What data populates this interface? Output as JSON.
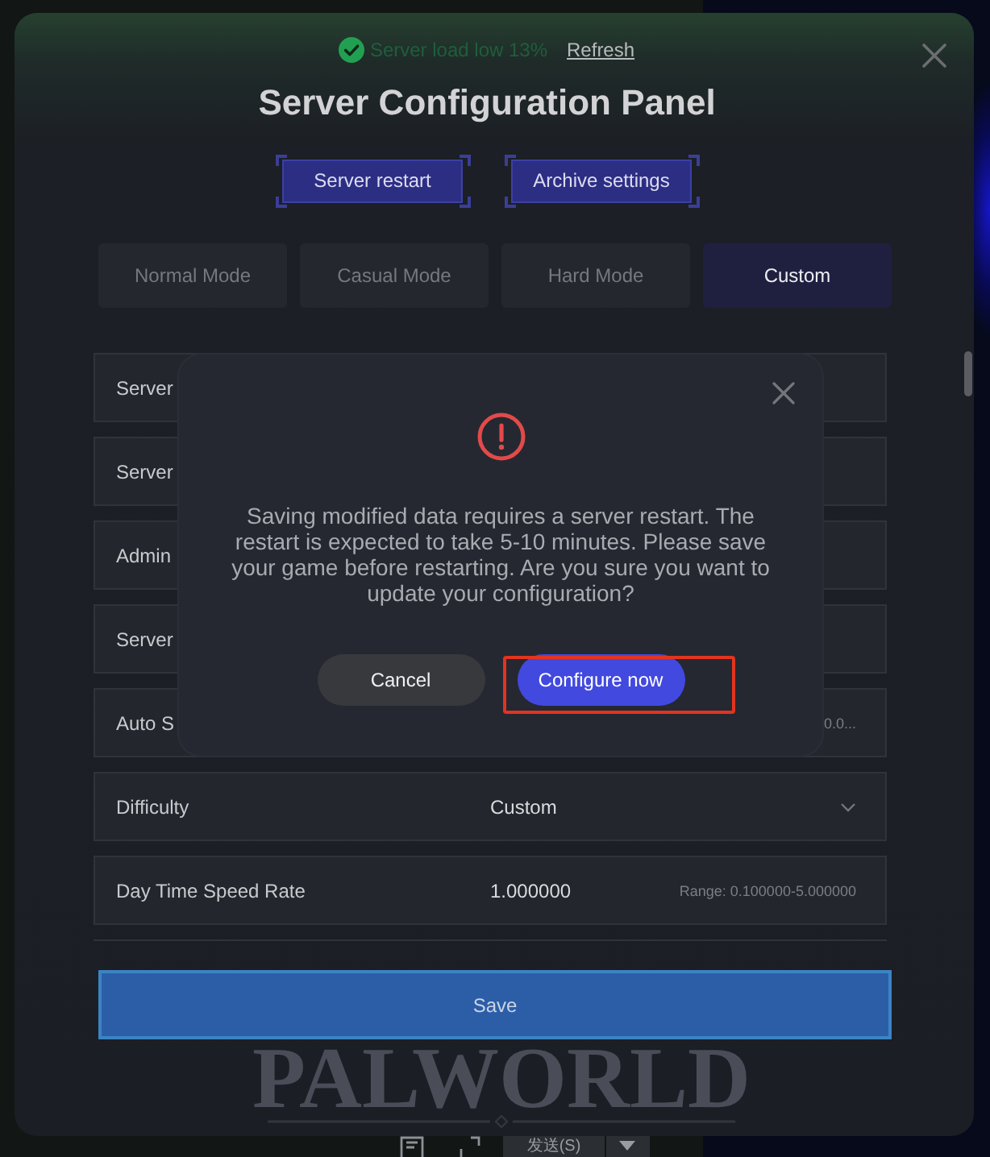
{
  "status": {
    "text": "Server load low 13%",
    "link": "Refresh"
  },
  "title": "Server Configuration Panel",
  "actions": [
    "Server restart",
    "Archive settings"
  ],
  "modes": [
    {
      "label": "Normal Mode",
      "selected": false
    },
    {
      "label": "Casual Mode",
      "selected": false
    },
    {
      "label": "Hard Mode",
      "selected": false
    },
    {
      "label": "Custom",
      "selected": true
    }
  ],
  "settings": [
    {
      "kind": "text",
      "label": "Server"
    },
    {
      "kind": "text",
      "label": "Server"
    },
    {
      "kind": "text",
      "label": "Admin"
    },
    {
      "kind": "text",
      "label": "Server"
    },
    {
      "kind": "text",
      "label": "Auto S",
      "hint": "0.0..."
    },
    {
      "kind": "select",
      "label": "Difficulty",
      "value": "Custom"
    },
    {
      "kind": "number",
      "label": "Day Time Speed Rate",
      "value": "1.000000",
      "hint": "Range: 0.100000-5.000000"
    }
  ],
  "save": "Save",
  "logo": "PALWORLD",
  "dialog": {
    "message": "Saving modified data requires a server restart. The restart is expected to take 5-10 minutes. Please save your game before restarting. Are you sure you want to update your configuration?",
    "buttons": [
      {
        "label": "Cancel",
        "kind": "secondary",
        "highlighted": false
      },
      {
        "label": "Configure now",
        "kind": "primary",
        "highlighted": true
      }
    ]
  },
  "toolbar": {
    "send": "发送(S)"
  }
}
